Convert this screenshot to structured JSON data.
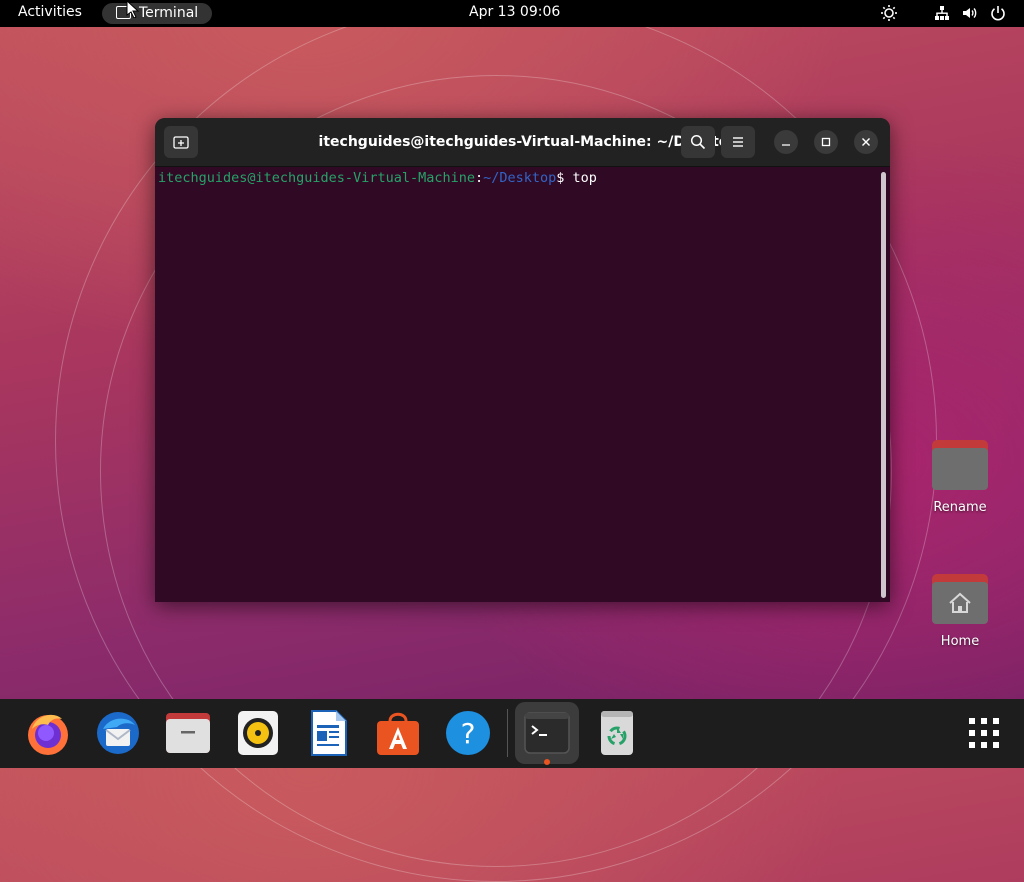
{
  "topbar": {
    "activities": "Activities",
    "app_name": "Terminal",
    "clock": "Apr 13  09:06",
    "icons": [
      "brightness-icon",
      "network-icon",
      "volume-icon",
      "power-icon"
    ]
  },
  "terminal": {
    "title": "itechguides@itechguides-Virtual-Machine: ~/Desktop",
    "prompt_user": "itechguides@itechguides-Virtual-Machine",
    "prompt_sep": ":",
    "prompt_path": "~/Desktop",
    "prompt_symbol": "$",
    "command": " top",
    "colors": {
      "background": "#300a24",
      "user": "#26a269",
      "path": "#3264c8"
    }
  },
  "desktop": {
    "icons": [
      {
        "label": "Rename",
        "icon": "folder-icon"
      },
      {
        "label": "Home",
        "icon": "home-folder-icon"
      }
    ]
  },
  "dock": {
    "apps": [
      "firefox-icon",
      "thunderbird-icon",
      "files-icon",
      "rhythmbox-icon",
      "libreoffice-writer-icon",
      "software-center-icon",
      "help-icon",
      "terminal-icon",
      "trash-icon"
    ],
    "show_apps": "show-applications-icon",
    "accent": "#e95420"
  }
}
